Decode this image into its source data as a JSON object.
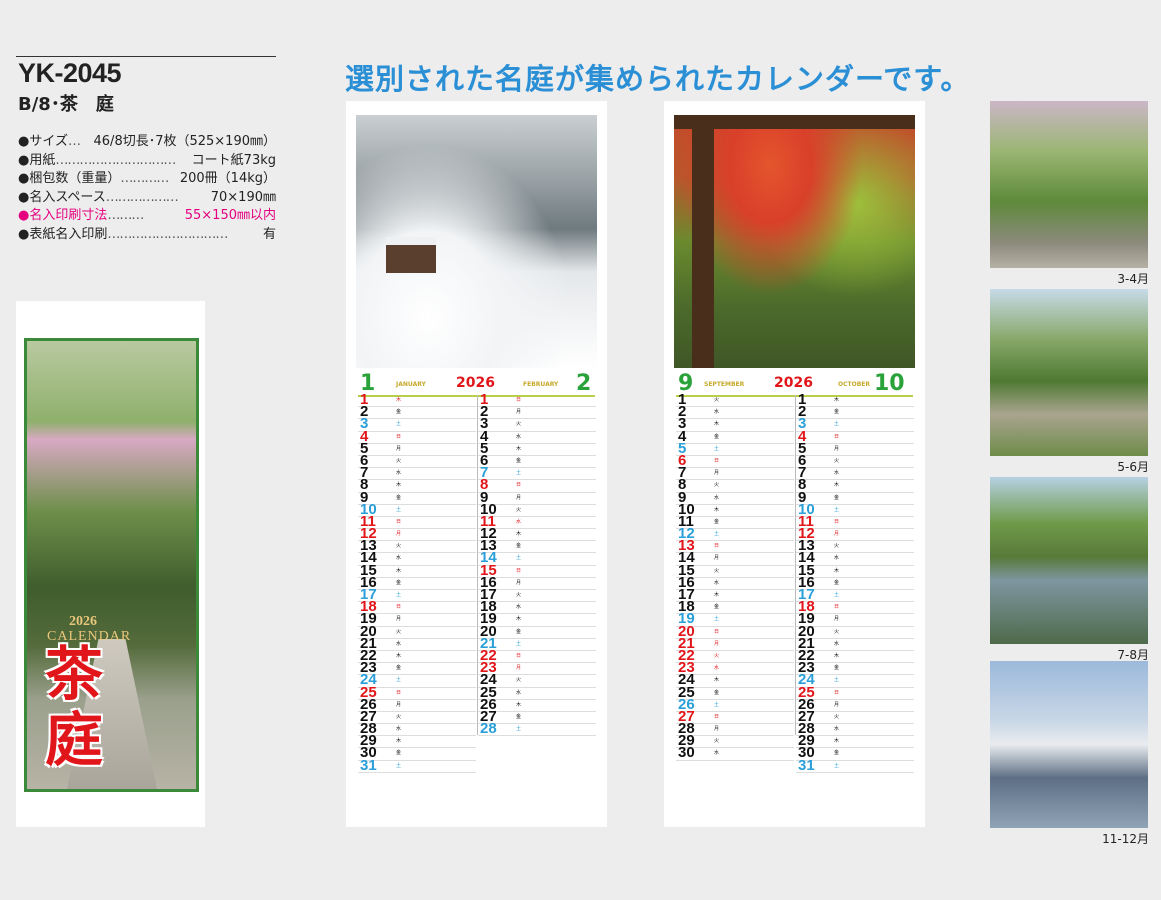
{
  "product": {
    "code": "YK-2045",
    "subtitle": "B/8･茶　庭"
  },
  "heading": "選別された名庭が集められたカレンダーです。",
  "specs": [
    {
      "label": "●サイズ",
      "dots": "…",
      "value": "46/8切長･7枚（525×190㎜）"
    },
    {
      "label": "●用紙",
      "dots": "…………………………",
      "value": "コート紙73kg"
    },
    {
      "label": "●梱包数（重量）",
      "dots": "…………",
      "value": "200冊（14kg）"
    },
    {
      "label": "●名入スペース",
      "dots": "………………",
      "value": "70×190㎜"
    },
    {
      "label": "●名入印刷寸法",
      "dots": "………",
      "value": "55×150㎜以内",
      "highlight": true
    },
    {
      "label": "●表紙名入印刷",
      "dots": "…………………………",
      "value": "有"
    }
  ],
  "cover": {
    "year": "2026",
    "calendar_word": "CALENDAR",
    "title_line1": "茶",
    "title_line2": "庭"
  },
  "sheet1": {
    "left_month_num": "1",
    "left_month_name": "JANUARY",
    "year": "2026",
    "right_month_name": "FEBRUARY",
    "right_month_num": "2",
    "left_days": [
      {
        "n": "1",
        "w": "木",
        "c": "red"
      },
      {
        "n": "2",
        "w": "金",
        "c": "black"
      },
      {
        "n": "3",
        "w": "土",
        "c": "blue"
      },
      {
        "n": "4",
        "w": "日",
        "c": "red"
      },
      {
        "n": "5",
        "w": "月",
        "c": "black"
      },
      {
        "n": "6",
        "w": "火",
        "c": "black"
      },
      {
        "n": "7",
        "w": "水",
        "c": "black"
      },
      {
        "n": "8",
        "w": "木",
        "c": "black"
      },
      {
        "n": "9",
        "w": "金",
        "c": "black"
      },
      {
        "n": "10",
        "w": "土",
        "c": "blue"
      },
      {
        "n": "11",
        "w": "日",
        "c": "red"
      },
      {
        "n": "12",
        "w": "月",
        "c": "red"
      },
      {
        "n": "13",
        "w": "火",
        "c": "black"
      },
      {
        "n": "14",
        "w": "水",
        "c": "black"
      },
      {
        "n": "15",
        "w": "木",
        "c": "black"
      },
      {
        "n": "16",
        "w": "金",
        "c": "black"
      },
      {
        "n": "17",
        "w": "土",
        "c": "blue"
      },
      {
        "n": "18",
        "w": "日",
        "c": "red"
      },
      {
        "n": "19",
        "w": "月",
        "c": "black"
      },
      {
        "n": "20",
        "w": "火",
        "c": "black"
      },
      {
        "n": "21",
        "w": "水",
        "c": "black"
      },
      {
        "n": "22",
        "w": "木",
        "c": "black"
      },
      {
        "n": "23",
        "w": "金",
        "c": "black"
      },
      {
        "n": "24",
        "w": "土",
        "c": "blue"
      },
      {
        "n": "25",
        "w": "日",
        "c": "red"
      },
      {
        "n": "26",
        "w": "月",
        "c": "black"
      },
      {
        "n": "27",
        "w": "火",
        "c": "black"
      },
      {
        "n": "28",
        "w": "水",
        "c": "black"
      },
      {
        "n": "29",
        "w": "木",
        "c": "black"
      },
      {
        "n": "30",
        "w": "金",
        "c": "black"
      },
      {
        "n": "31",
        "w": "土",
        "c": "blue"
      }
    ],
    "right_days": [
      {
        "n": "1",
        "w": "日",
        "c": "red"
      },
      {
        "n": "2",
        "w": "月",
        "c": "black"
      },
      {
        "n": "3",
        "w": "火",
        "c": "black"
      },
      {
        "n": "4",
        "w": "水",
        "c": "black"
      },
      {
        "n": "5",
        "w": "木",
        "c": "black"
      },
      {
        "n": "6",
        "w": "金",
        "c": "black"
      },
      {
        "n": "7",
        "w": "土",
        "c": "blue"
      },
      {
        "n": "8",
        "w": "日",
        "c": "red"
      },
      {
        "n": "9",
        "w": "月",
        "c": "black"
      },
      {
        "n": "10",
        "w": "火",
        "c": "black"
      },
      {
        "n": "11",
        "w": "水",
        "c": "red"
      },
      {
        "n": "12",
        "w": "木",
        "c": "black"
      },
      {
        "n": "13",
        "w": "金",
        "c": "black"
      },
      {
        "n": "14",
        "w": "土",
        "c": "blue"
      },
      {
        "n": "15",
        "w": "日",
        "c": "red"
      },
      {
        "n": "16",
        "w": "月",
        "c": "black"
      },
      {
        "n": "17",
        "w": "火",
        "c": "black"
      },
      {
        "n": "18",
        "w": "水",
        "c": "black"
      },
      {
        "n": "19",
        "w": "木",
        "c": "black"
      },
      {
        "n": "20",
        "w": "金",
        "c": "black"
      },
      {
        "n": "21",
        "w": "土",
        "c": "blue"
      },
      {
        "n": "22",
        "w": "日",
        "c": "red"
      },
      {
        "n": "23",
        "w": "月",
        "c": "red"
      },
      {
        "n": "24",
        "w": "火",
        "c": "black"
      },
      {
        "n": "25",
        "w": "水",
        "c": "black"
      },
      {
        "n": "26",
        "w": "木",
        "c": "black"
      },
      {
        "n": "27",
        "w": "金",
        "c": "black"
      },
      {
        "n": "28",
        "w": "土",
        "c": "blue"
      }
    ]
  },
  "sheet2": {
    "left_month_num": "9",
    "left_month_name": "SEPTEMBER",
    "year": "2026",
    "right_month_name": "OCTOBER",
    "right_month_num": "10",
    "left_days": [
      {
        "n": "1",
        "w": "火",
        "c": "black"
      },
      {
        "n": "2",
        "w": "水",
        "c": "black"
      },
      {
        "n": "3",
        "w": "木",
        "c": "black"
      },
      {
        "n": "4",
        "w": "金",
        "c": "black"
      },
      {
        "n": "5",
        "w": "土",
        "c": "blue"
      },
      {
        "n": "6",
        "w": "日",
        "c": "red"
      },
      {
        "n": "7",
        "w": "月",
        "c": "black"
      },
      {
        "n": "8",
        "w": "火",
        "c": "black"
      },
      {
        "n": "9",
        "w": "水",
        "c": "black"
      },
      {
        "n": "10",
        "w": "木",
        "c": "black"
      },
      {
        "n": "11",
        "w": "金",
        "c": "black"
      },
      {
        "n": "12",
        "w": "土",
        "c": "blue"
      },
      {
        "n": "13",
        "w": "日",
        "c": "red"
      },
      {
        "n": "14",
        "w": "月",
        "c": "black"
      },
      {
        "n": "15",
        "w": "火",
        "c": "black"
      },
      {
        "n": "16",
        "w": "水",
        "c": "black"
      },
      {
        "n": "17",
        "w": "木",
        "c": "black"
      },
      {
        "n": "18",
        "w": "金",
        "c": "black"
      },
      {
        "n": "19",
        "w": "土",
        "c": "blue"
      },
      {
        "n": "20",
        "w": "日",
        "c": "red"
      },
      {
        "n": "21",
        "w": "月",
        "c": "red"
      },
      {
        "n": "22",
        "w": "火",
        "c": "red"
      },
      {
        "n": "23",
        "w": "水",
        "c": "red"
      },
      {
        "n": "24",
        "w": "木",
        "c": "black"
      },
      {
        "n": "25",
        "w": "金",
        "c": "black"
      },
      {
        "n": "26",
        "w": "土",
        "c": "blue"
      },
      {
        "n": "27",
        "w": "日",
        "c": "red"
      },
      {
        "n": "28",
        "w": "月",
        "c": "black"
      },
      {
        "n": "29",
        "w": "火",
        "c": "black"
      },
      {
        "n": "30",
        "w": "水",
        "c": "black"
      }
    ],
    "right_days": [
      {
        "n": "1",
        "w": "木",
        "c": "black"
      },
      {
        "n": "2",
        "w": "金",
        "c": "black"
      },
      {
        "n": "3",
        "w": "土",
        "c": "blue"
      },
      {
        "n": "4",
        "w": "日",
        "c": "red"
      },
      {
        "n": "5",
        "w": "月",
        "c": "black"
      },
      {
        "n": "6",
        "w": "火",
        "c": "black"
      },
      {
        "n": "7",
        "w": "水",
        "c": "black"
      },
      {
        "n": "8",
        "w": "木",
        "c": "black"
      },
      {
        "n": "9",
        "w": "金",
        "c": "black"
      },
      {
        "n": "10",
        "w": "土",
        "c": "blue"
      },
      {
        "n": "11",
        "w": "日",
        "c": "red"
      },
      {
        "n": "12",
        "w": "月",
        "c": "red"
      },
      {
        "n": "13",
        "w": "火",
        "c": "black"
      },
      {
        "n": "14",
        "w": "水",
        "c": "black"
      },
      {
        "n": "15",
        "w": "木",
        "c": "black"
      },
      {
        "n": "16",
        "w": "金",
        "c": "black"
      },
      {
        "n": "17",
        "w": "土",
        "c": "blue"
      },
      {
        "n": "18",
        "w": "日",
        "c": "red"
      },
      {
        "n": "19",
        "w": "月",
        "c": "black"
      },
      {
        "n": "20",
        "w": "火",
        "c": "black"
      },
      {
        "n": "21",
        "w": "水",
        "c": "black"
      },
      {
        "n": "22",
        "w": "木",
        "c": "black"
      },
      {
        "n": "23",
        "w": "金",
        "c": "black"
      },
      {
        "n": "24",
        "w": "土",
        "c": "blue"
      },
      {
        "n": "25",
        "w": "日",
        "c": "red"
      },
      {
        "n": "26",
        "w": "月",
        "c": "black"
      },
      {
        "n": "27",
        "w": "火",
        "c": "black"
      },
      {
        "n": "28",
        "w": "水",
        "c": "black"
      },
      {
        "n": "29",
        "w": "木",
        "c": "black"
      },
      {
        "n": "30",
        "w": "金",
        "c": "black"
      },
      {
        "n": "31",
        "w": "土",
        "c": "blue"
      }
    ]
  },
  "thumbnails": [
    {
      "label": "3-4月"
    },
    {
      "label": "5-6月"
    },
    {
      "label": "7-8月"
    },
    {
      "label": "11-12月"
    }
  ],
  "colors": {
    "heading": "#2b8fd6",
    "highlight": "#e4007f",
    "month_green": "#2aa23a",
    "year_red": "#e1161b",
    "saturday_blue": "#2a9fd8"
  }
}
